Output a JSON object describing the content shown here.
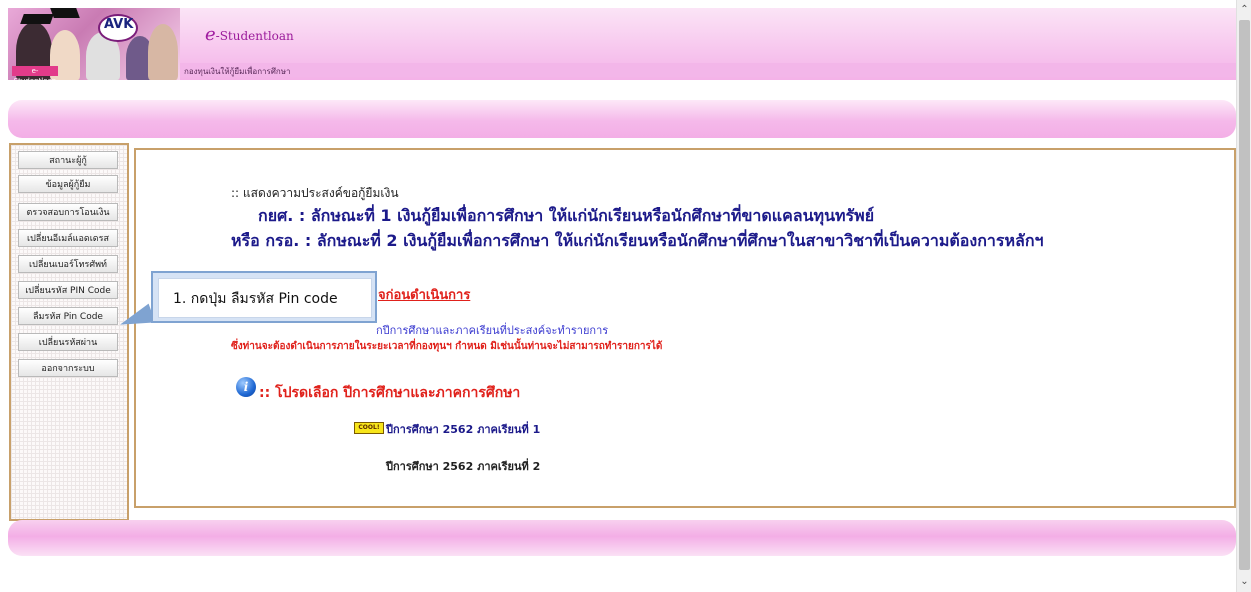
{
  "header": {
    "app_title_prefix": "e",
    "app_title_rest": "-Studentloan",
    "subtitle": "กองทุนเงินให้กู้ยืมเพื่อการศึกษา",
    "logo_text": "AVK",
    "photo_tag": "e-Studentloan"
  },
  "sidebar": {
    "items": [
      {
        "label": "สถานะผู้กู้"
      },
      {
        "label": "ข้อมูลผู้กู้ยืม"
      },
      {
        "label": "ตรวจสอบการโอนเงิน"
      },
      {
        "label": "เปลี่ยนอีเมล์แอดเดรส"
      },
      {
        "label": "เปลี่ยนเบอร์โทรศัพท์"
      },
      {
        "label": "เปลี่ยนรหัส PIN Code"
      },
      {
        "label": "ลืมรหัส Pin Code"
      },
      {
        "label": "เปลี่ยนรหัสผ่าน"
      },
      {
        "label": "ออกจากระบบ"
      }
    ]
  },
  "content": {
    "line1": ":: แสดงความประสงค์ขอกู้ยืมเงิน",
    "line2": "กยศ. : ลักษณะที่ 1 เงินกู้ยืมเพื่อการศึกษา ให้แก่นักเรียนหรือนักศึกษาที่ขาดแคลนทุนทรัพย์",
    "line3": "หรือ กรอ. : ลักษณะที่ 2 เงินกู้ยืมเพื่อการศึกษา ให้แก่นักเรียนหรือนักศึกษาที่ศึกษาในสาขาวิชาที่เป็นความต้องการหลักฯ",
    "notice_title": "จก่อนดำเนินการ",
    "notice_line1": "กปีการศึกษาและภาคเรียนที่ประสงค์จะทำรายการ",
    "notice_line2": "ซึ่งท่านจะต้องดำเนินการภายในระยะเวลาที่กองทุนฯ กำหนด มิเช่นนั้นท่านจะไม่สามารถทำรายการได้",
    "info_icon_glyph": "i",
    "select_title": ":: โปรดเลือก ปีการศึกษาและภาคการศึกษา",
    "cool_badge": "COOL!",
    "term1": "ปีการศึกษา  2562  ภาคเรียนที่  1",
    "term2": "ปีการศึกษา  2562  ภาคเรียนที่  2"
  },
  "callout": {
    "text": "1. กดปุ่ม ลืมรหัส Pin code"
  },
  "scrollbar": {
    "up_glyph": "⌃",
    "down_glyph": "⌄"
  }
}
